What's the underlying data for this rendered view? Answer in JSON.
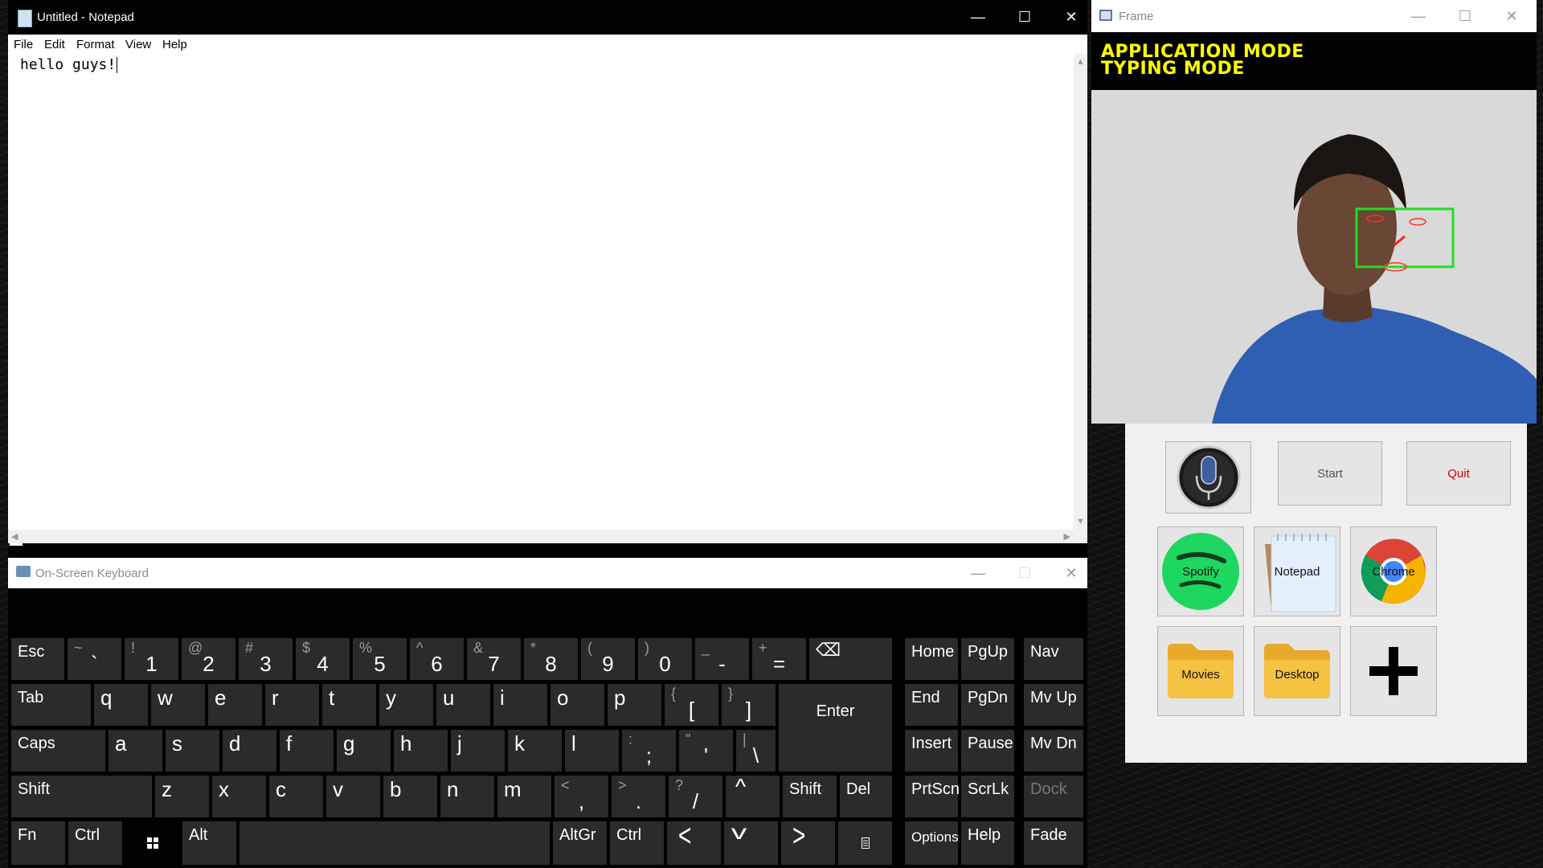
{
  "notepad": {
    "title": "Untitled - Notepad",
    "menu": [
      "File",
      "Edit",
      "Format",
      "View",
      "Help"
    ],
    "content": "hello guys!",
    "window_buttons": {
      "minimize": "—",
      "maximize": "☐",
      "close": "✕"
    }
  },
  "osk": {
    "title": "On-Screen Keyboard",
    "window_buttons": {
      "minimize": "—",
      "maximize": "☐",
      "close": "✕"
    },
    "keys": {
      "esc": "Esc",
      "tilde_s": "~",
      "tilde_m": "`",
      "k1_s": "!",
      "k1_m": "1",
      "k2_s": "@",
      "k2_m": "2",
      "k3_s": "#",
      "k3_m": "3",
      "k4_s": "$",
      "k4_m": "4",
      "k5_s": "%",
      "k5_m": "5",
      "k6_s": "^",
      "k6_m": "6",
      "k7_s": "&",
      "k7_m": "7",
      "k8_s": "*",
      "k8_m": "8",
      "k9_s": "(",
      "k9_m": "9",
      "k0_s": ")",
      "k0_m": "0",
      "minus_s": "_",
      "minus_m": "-",
      "plus_s": "+",
      "plus_m": "=",
      "backspace": "⌫",
      "tab": "Tab",
      "q": "q",
      "w": "w",
      "e": "e",
      "r": "r",
      "t": "t",
      "y": "y",
      "u": "u",
      "i": "i",
      "o": "o",
      "p": "p",
      "lbr_s": "{",
      "lbr_m": "[",
      "rbr_s": "}",
      "rbr_m": "]",
      "enter": "Enter",
      "caps": "Caps",
      "a": "a",
      "s": "s",
      "d": "d",
      "f": "f",
      "g": "g",
      "h": "h",
      "j": "j",
      "k": "k",
      "l": "l",
      "semi_s": ":",
      "semi_m": ";",
      "quote_s": "\"",
      "quote_m": "'",
      "bslash_s": "|",
      "bslash_m": "\\",
      "shift": "Shift",
      "z": "z",
      "x": "x",
      "c": "c",
      "v": "v",
      "b": "b",
      "n": "n",
      "m": "m",
      "comma_s": "<",
      "comma_m": ",",
      "period_s": ">",
      "period_m": ".",
      "slash_s": "?",
      "slash_m": "/",
      "up": "^",
      "rshift": "Shift",
      "del": "Del",
      "fn": "Fn",
      "ctrl": "Ctrl",
      "alt": "Alt",
      "altgr": "AltGr",
      "rctrl": "Ctrl",
      "left": "<",
      "down": "v",
      "right": ">",
      "home": "Home",
      "pgup": "PgUp",
      "nav": "Nav",
      "end": "End",
      "pgdn": "PgDn",
      "mvup": "Mv Up",
      "insert": "Insert",
      "pause": "Pause",
      "mvdn": "Mv Dn",
      "prtscn": "PrtScn",
      "scrlk": "ScrLk",
      "dock": "Dock",
      "options": "Options",
      "help": "Help",
      "fade": "Fade"
    }
  },
  "frame": {
    "title": "Frame",
    "window_buttons": {
      "minimize": "—",
      "maximize": "☐",
      "close": "✕"
    },
    "mode_line1": "APPLICATION MODE",
    "mode_line2": "TYPING MODE"
  },
  "panel": {
    "start_label": "Start",
    "quit_label": "Quit",
    "apps": [
      "Spotify",
      "Notepad",
      "Chrome",
      "Movies",
      "Desktop"
    ]
  },
  "colors": {
    "mode_text": "#ffff00",
    "face_box": "#22dd22",
    "quit_text": "#d40000",
    "spotify": "#1ed760",
    "folder": "#f5c242"
  }
}
